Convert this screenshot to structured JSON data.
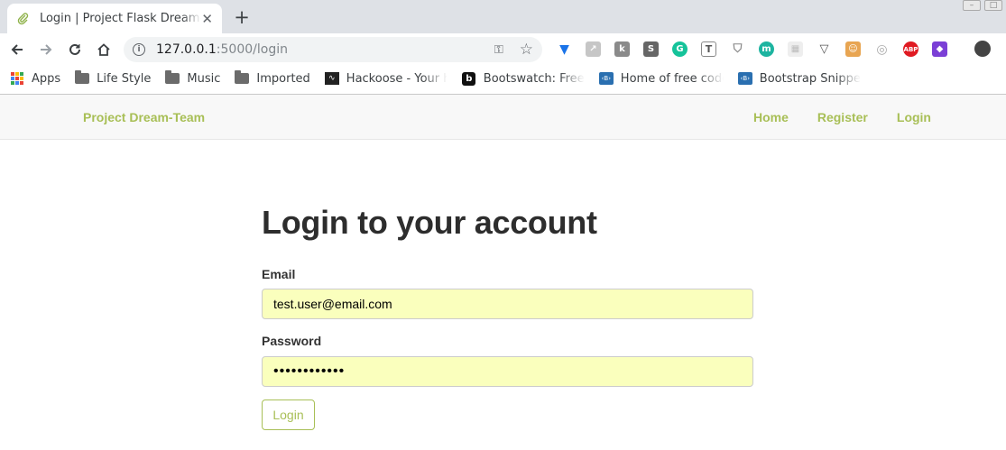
{
  "browser": {
    "tab_title": "Login | Project Flask Dream-Team",
    "tab_close": "✕",
    "new_tab": "+",
    "url_host": "127.0.0.1",
    "url_rest": ":5000/login",
    "bookmarks": [
      {
        "label": "Apps",
        "icon": "apps-grid-icon"
      },
      {
        "label": "Life Style",
        "icon": "folder-icon"
      },
      {
        "label": "Music",
        "icon": "folder-icon"
      },
      {
        "label": "Imported",
        "icon": "folder-icon"
      },
      {
        "label": "Hackoose - Your ha",
        "icon": "hackoose-icon"
      },
      {
        "label": "Bootswatch: Free th",
        "icon": "bootswatch-icon"
      },
      {
        "label": "Home of free code",
        "icon": "bootstrap-icon"
      },
      {
        "label": "Bootstrap Snippet",
        "icon": "bootstrap-icon"
      }
    ]
  },
  "site": {
    "brand": "Project Dream-Team",
    "nav": {
      "home": "Home",
      "register": "Register",
      "login": "Login"
    },
    "accent_color": "#a8bf56"
  },
  "form": {
    "heading": "Login to your account",
    "email_label": "Email",
    "email_value": "test.user@email.com",
    "password_label": "Password",
    "password_value": "••••••••••••",
    "submit_label": "Login",
    "autofill_color": "#faffbd"
  }
}
